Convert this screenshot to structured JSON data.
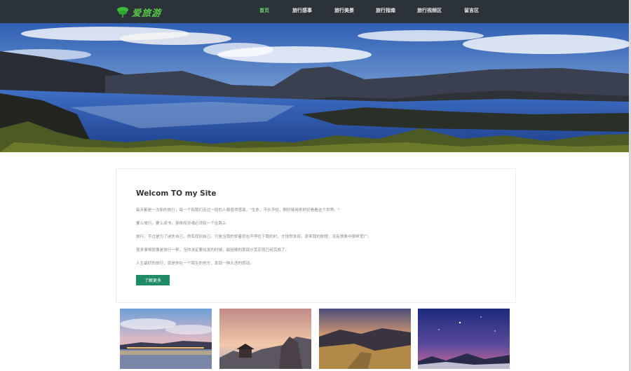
{
  "nav": {
    "logo_text": "爱旅游",
    "links": [
      {
        "label": "首页",
        "active": true
      },
      {
        "label": "旅行感事",
        "active": false
      },
      {
        "label": "旅行美景",
        "active": false
      },
      {
        "label": "旅行指南",
        "active": false
      },
      {
        "label": "旅行视频区",
        "active": false
      },
      {
        "label": "留言区",
        "active": false
      }
    ]
  },
  "intro": {
    "title": "Welcom TO my Site",
    "paragraphs": [
      "每天都是一次新的旅行，每一个和我们走过一段的人都值得感激。\"生命，不长不短，刚好够用来好好看看这个世界。\"",
      "要么旅行，要么读书，身体和灵魂必须有一个在路上",
      "旅行，不过是为了迷失自己，然后找到自己。只是当我的举着背包不停往下跑的时，才恍然发现，原来我的旅程，没有想象中那样宽广。",
      "很多事情就像是旅行一样，当你决定要出发的时候，最困难的那部分其实就已经完成了。",
      "人生最好的旅行，就是你在一个陌生的地方，发现一种久违的感动。"
    ],
    "button_label": "了解更多"
  },
  "colors": {
    "nav_bg": "#2c3338",
    "active_link": "#6bd46b",
    "button_bg": "#1f8c67"
  }
}
